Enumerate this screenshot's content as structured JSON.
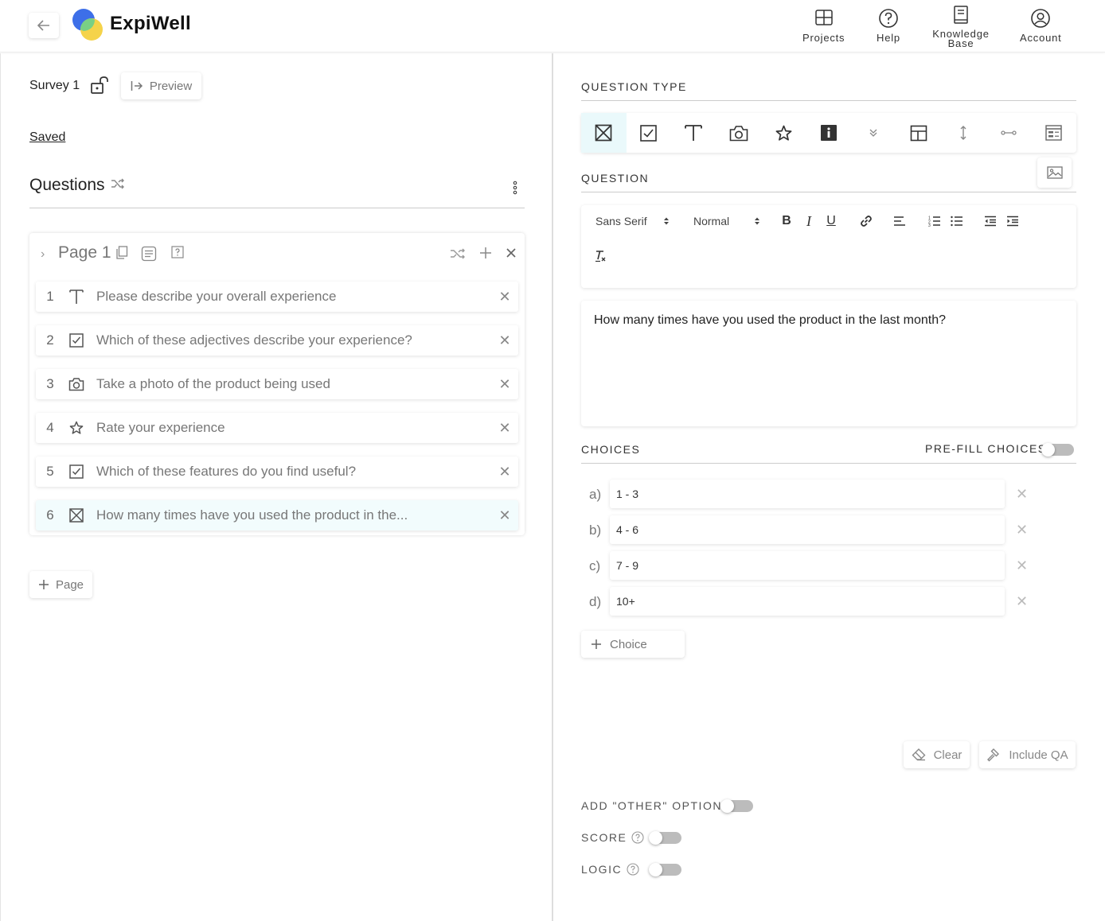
{
  "app": {
    "name": "ExpiWell",
    "nav": [
      {
        "label": "Projects",
        "icon": "grid-icon"
      },
      {
        "label": "Help",
        "icon": "help-circle-icon"
      },
      {
        "label": "Knowledge Base",
        "icon": "book-icon"
      },
      {
        "label": "Account",
        "icon": "account-circle-icon"
      }
    ]
  },
  "survey": {
    "title": "Survey 1",
    "preview_label": "Preview",
    "saved_label": "Saved",
    "questions_title": "Questions"
  },
  "page": {
    "title": "Page 1",
    "add_page_label": "Page",
    "questions": [
      {
        "num": "1",
        "type_icon": "text-icon",
        "text": "Please describe your overall experience"
      },
      {
        "num": "2",
        "type_icon": "checkbox-icon",
        "text": "Which of these adjectives describe your experience?"
      },
      {
        "num": "3",
        "type_icon": "camera-icon",
        "text": "Take a photo of the product being used"
      },
      {
        "num": "4",
        "type_icon": "star-icon",
        "text": "Rate your experience"
      },
      {
        "num": "5",
        "type_icon": "checkbox-icon",
        "text": "Which of these features do you find useful?"
      },
      {
        "num": "6",
        "type_icon": "single-choice-icon",
        "text": "How many times have you used the product in the..."
      }
    ]
  },
  "editor": {
    "question_type_label": "QUESTION TYPE",
    "question_label": "QUESTION",
    "font_family": "Sans Serif",
    "font_size": "Normal",
    "question_text": "How many times have you used the product in the last month?",
    "choices_label": "CHOICES",
    "prefill_label": "PRE-FILL CHOICES?",
    "prefill_on": false,
    "choices": [
      {
        "letter": "a)",
        "value": "1 - 3"
      },
      {
        "letter": "b)",
        "value": "4 - 6"
      },
      {
        "letter": "c)",
        "value": "7 - 9"
      },
      {
        "letter": "d)",
        "value": "10+"
      }
    ],
    "add_choice_label": "Choice",
    "clear_label": "Clear",
    "include_qa_label": "Include QA",
    "other_option_label": "ADD \"OTHER\" OPTION",
    "score_label": "SCORE",
    "logic_label": "LOGIC",
    "other_on": false,
    "score_on": false,
    "logic_on": false
  },
  "colors": {
    "active_bg": "#eaf9fb",
    "logo_blue": "#3d6fe8",
    "logo_yellow": "#f5d34a",
    "logo_green": "#6ccf8c"
  }
}
